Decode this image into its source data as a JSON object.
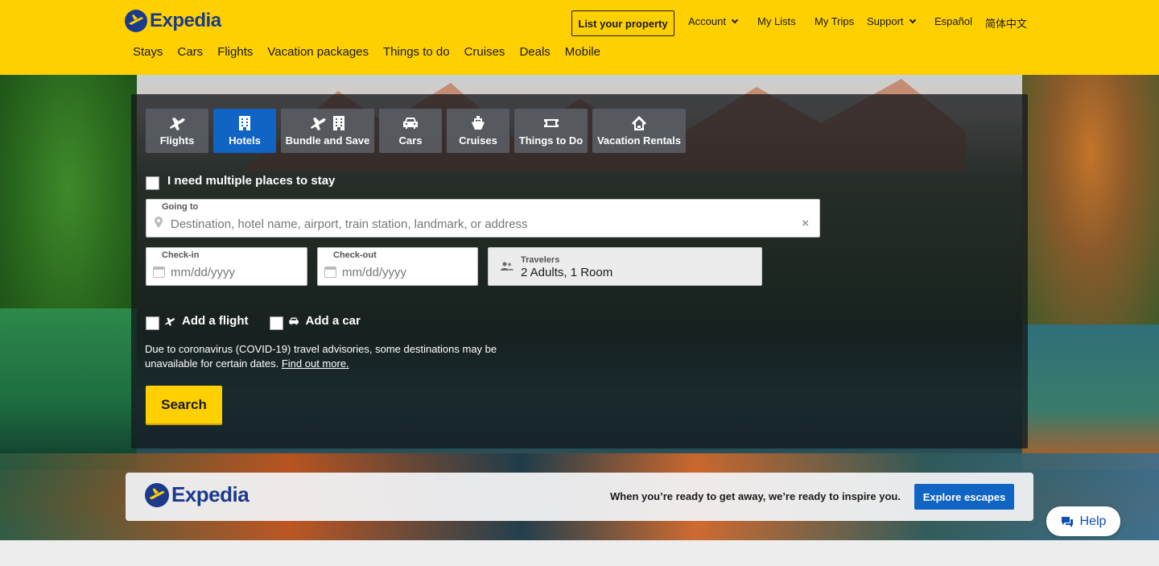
{
  "header": {
    "brand": "Expedia",
    "list_property": "List your property",
    "top_links": {
      "account": "Account",
      "my_lists": "My Lists",
      "my_trips": "My Trips",
      "support": "Support",
      "espanol": "Español",
      "chinese": "简体中文"
    },
    "nav": [
      "Stays",
      "Cars",
      "Flights",
      "Vacation packages",
      "Things to do",
      "Cruises",
      "Deals",
      "Mobile"
    ]
  },
  "search": {
    "tabs": [
      {
        "label": "Flights",
        "icon": "plane-icon",
        "active": false
      },
      {
        "label": "Hotels",
        "icon": "building-icon",
        "active": true
      },
      {
        "label": "Bundle and Save",
        "icon": "plane-building-icon",
        "active": false
      },
      {
        "label": "Cars",
        "icon": "car-icon",
        "active": false
      },
      {
        "label": "Cruises",
        "icon": "ship-icon",
        "active": false
      },
      {
        "label": "Things to Do",
        "icon": "ticket-icon",
        "active": false
      },
      {
        "label": "Vacation Rentals",
        "icon": "house-icon",
        "active": false
      }
    ],
    "multi_places": "I need multiple places to stay",
    "going_to": {
      "label": "Going to",
      "placeholder": "Destination, hotel name, airport, train station, landmark, or address"
    },
    "check_in": {
      "label": "Check-in",
      "placeholder": "mm/dd/yyyy"
    },
    "check_out": {
      "label": "Check-out",
      "placeholder": "mm/dd/yyyy"
    },
    "travelers": {
      "label": "Travelers",
      "value": "2 Adults, 1 Room"
    },
    "add_flight": "Add a flight",
    "add_car": "Add a car",
    "notice": "Due to coronavirus (COVID-19) travel advisories, some destinations may be unavailable for certain dates.",
    "notice_link": "Find out more.",
    "search_button": "Search"
  },
  "promo": {
    "brand": "Expedia",
    "tagline": "When you’re ready to get away, we’re ready to inspire you.",
    "button": "Explore escapes"
  },
  "help": "Help",
  "colors": {
    "brand_yellow": "#fed000",
    "brand_blue": "#0f64c4",
    "logo_navy": "#1b3a8c"
  }
}
